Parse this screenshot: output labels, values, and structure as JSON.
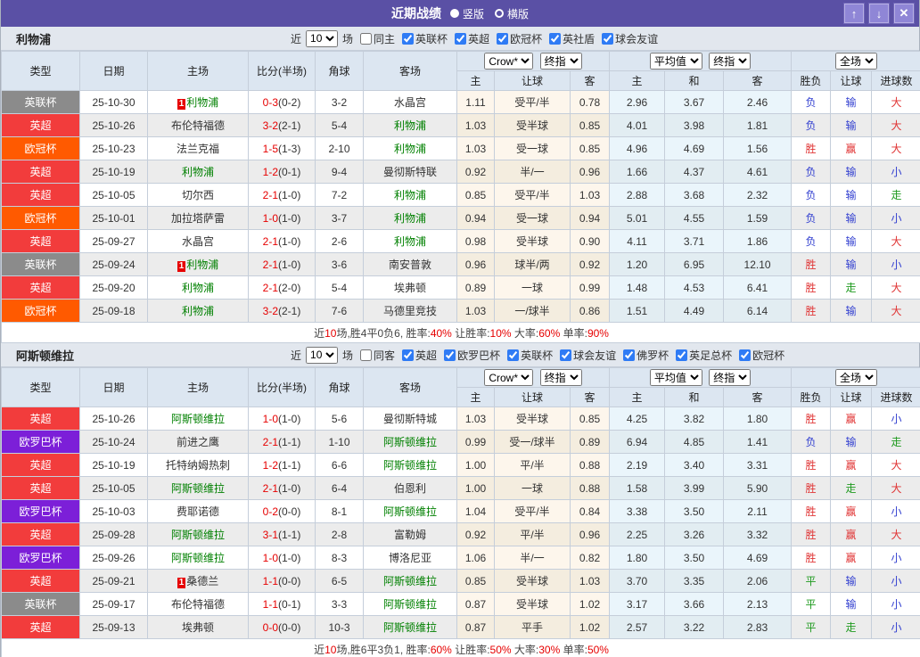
{
  "titlebar": {
    "title": "近期战绩",
    "radio_vertical": "竖版",
    "radio_horizontal": "横版",
    "btn_up": "↑",
    "btn_down": "↓",
    "btn_close": "✕"
  },
  "table_header": {
    "cols": [
      "类型",
      "日期",
      "主场",
      "比分(半场)",
      "角球",
      "客场"
    ],
    "book_select": "Crow*",
    "final_select": "终指",
    "avg_select": "平均值",
    "final_select2": "终指",
    "scope_select": "全场",
    "crow_sub": [
      "主",
      "让球",
      "客"
    ],
    "avg_sub": [
      "主",
      "和",
      "客"
    ],
    "result_sub": [
      "胜负",
      "让球",
      "进球数"
    ]
  },
  "league_colors": {
    "英超": "#F23C3C",
    "英联杯": "#8B8B8B",
    "欧冠杯": "#FF5A00",
    "欧罗巴杯": "#7C1FD8"
  },
  "result_colors": {
    "胜": "c-red",
    "负": "c-blue",
    "平": "c-green",
    "赢": "c-red",
    "输": "c-blue",
    "走": "c-green",
    "大": "c-red",
    "小": "c-blue"
  },
  "sections": [
    {
      "team": "利物浦",
      "filter": {
        "near": "近",
        "games": "10",
        "games_suffix": "场",
        "same": "同主",
        "leagues": [
          "英联杯",
          "英超",
          "欧冠杯",
          "英社盾",
          "球会友谊"
        ]
      },
      "rows": [
        {
          "league": "英联杯",
          "date": "25-10-30",
          "home": "利物浦",
          "home_team": true,
          "home_rank": "1",
          "score": "0-3",
          "half": "(0-2)",
          "corner": "3-2",
          "away": "水晶宫",
          "away_team": false,
          "o1": [
            "1.11",
            "受平/半",
            "0.78"
          ],
          "o2": [
            "2.96",
            "3.67",
            "2.46"
          ],
          "res": [
            "负",
            "输",
            "大"
          ]
        },
        {
          "league": "英超",
          "date": "25-10-26",
          "home": "布伦特福德",
          "home_team": false,
          "score": "3-2",
          "half": "(2-1)",
          "corner": "5-4",
          "away": "利物浦",
          "away_team": true,
          "o1": [
            "1.03",
            "受半球",
            "0.85"
          ],
          "o2": [
            "4.01",
            "3.98",
            "1.81"
          ],
          "res": [
            "负",
            "输",
            "大"
          ]
        },
        {
          "league": "欧冠杯",
          "date": "25-10-23",
          "home": "法兰克福",
          "home_team": false,
          "score": "1-5",
          "half": "(1-3)",
          "corner": "2-10",
          "away": "利物浦",
          "away_team": true,
          "o1": [
            "1.03",
            "受一球",
            "0.85"
          ],
          "o2": [
            "4.96",
            "4.69",
            "1.56"
          ],
          "res": [
            "胜",
            "赢",
            "大"
          ]
        },
        {
          "league": "英超",
          "date": "25-10-19",
          "home": "利物浦",
          "home_team": true,
          "score": "1-2",
          "half": "(0-1)",
          "corner": "9-4",
          "away": "曼彻斯特联",
          "away_team": false,
          "o1": [
            "0.92",
            "半/一",
            "0.96"
          ],
          "o2": [
            "1.66",
            "4.37",
            "4.61"
          ],
          "res": [
            "负",
            "输",
            "小"
          ]
        },
        {
          "league": "英超",
          "date": "25-10-05",
          "home": "切尔西",
          "home_team": false,
          "score": "2-1",
          "half": "(1-0)",
          "corner": "7-2",
          "away": "利物浦",
          "away_team": true,
          "o1": [
            "0.85",
            "受平/半",
            "1.03"
          ],
          "o2": [
            "2.88",
            "3.68",
            "2.32"
          ],
          "res": [
            "负",
            "输",
            "走"
          ]
        },
        {
          "league": "欧冠杯",
          "date": "25-10-01",
          "home": "加拉塔萨雷",
          "home_team": false,
          "score": "1-0",
          "half": "(1-0)",
          "corner": "3-7",
          "away": "利物浦",
          "away_team": true,
          "o1": [
            "0.94",
            "受一球",
            "0.94"
          ],
          "o2": [
            "5.01",
            "4.55",
            "1.59"
          ],
          "res": [
            "负",
            "输",
            "小"
          ]
        },
        {
          "league": "英超",
          "date": "25-09-27",
          "home": "水晶宫",
          "home_team": false,
          "score": "2-1",
          "half": "(1-0)",
          "corner": "2-6",
          "away": "利物浦",
          "away_team": true,
          "o1": [
            "0.98",
            "受半球",
            "0.90"
          ],
          "o2": [
            "4.11",
            "3.71",
            "1.86"
          ],
          "res": [
            "负",
            "输",
            "大"
          ]
        },
        {
          "league": "英联杯",
          "date": "25-09-24",
          "home": "利物浦",
          "home_team": true,
          "home_rank": "1",
          "score": "2-1",
          "half": "(1-0)",
          "corner": "3-6",
          "away": "南安普敦",
          "away_team": false,
          "o1": [
            "0.96",
            "球半/两",
            "0.92"
          ],
          "o2": [
            "1.20",
            "6.95",
            "12.10"
          ],
          "res": [
            "胜",
            "输",
            "小"
          ]
        },
        {
          "league": "英超",
          "date": "25-09-20",
          "home": "利物浦",
          "home_team": true,
          "score": "2-1",
          "half": "(2-0)",
          "corner": "5-4",
          "away": "埃弗顿",
          "away_team": false,
          "o1": [
            "0.89",
            "一球",
            "0.99"
          ],
          "o2": [
            "1.48",
            "4.53",
            "6.41"
          ],
          "res": [
            "胜",
            "走",
            "大"
          ]
        },
        {
          "league": "欧冠杯",
          "date": "25-09-18",
          "home": "利物浦",
          "home_team": true,
          "score": "3-2",
          "half": "(2-1)",
          "corner": "7-6",
          "away": "马德里竞技",
          "away_team": false,
          "o1": [
            "1.03",
            "一/球半",
            "0.86"
          ],
          "o2": [
            "1.51",
            "4.49",
            "6.14"
          ],
          "res": [
            "胜",
            "输",
            "大"
          ]
        }
      ],
      "summary": [
        {
          "text": "近",
          "red": false
        },
        {
          "text": "10",
          "red": true
        },
        {
          "text": "场,胜4平0负6, 胜率:",
          "red": false
        },
        {
          "text": "40%",
          "red": true
        },
        {
          "text": " 让胜率:",
          "red": false
        },
        {
          "text": "10%",
          "red": true
        },
        {
          "text": " 大率:",
          "red": false
        },
        {
          "text": "60%",
          "red": true
        },
        {
          "text": " 单率:",
          "red": false
        },
        {
          "text": "90%",
          "red": true
        }
      ]
    },
    {
      "team": "阿斯顿维拉",
      "filter": {
        "near": "近",
        "games": "10",
        "games_suffix": "场",
        "same": "同客",
        "leagues": [
          "英超",
          "欧罗巴杯",
          "英联杯",
          "球会友谊",
          "佛罗杯",
          "英足总杯",
          "欧冠杯"
        ]
      },
      "rows": [
        {
          "league": "英超",
          "date": "25-10-26",
          "home": "阿斯顿维拉",
          "home_team": true,
          "score": "1-0",
          "half": "(1-0)",
          "corner": "5-6",
          "away": "曼彻斯特城",
          "away_team": false,
          "o1": [
            "1.03",
            "受半球",
            "0.85"
          ],
          "o2": [
            "4.25",
            "3.82",
            "1.80"
          ],
          "res": [
            "胜",
            "赢",
            "小"
          ]
        },
        {
          "league": "欧罗巴杯",
          "date": "25-10-24",
          "home": "前进之鹰",
          "home_team": false,
          "score": "2-1",
          "half": "(1-1)",
          "corner": "1-10",
          "away": "阿斯顿维拉",
          "away_team": true,
          "o1": [
            "0.99",
            "受一/球半",
            "0.89"
          ],
          "o2": [
            "6.94",
            "4.85",
            "1.41"
          ],
          "res": [
            "负",
            "输",
            "走"
          ]
        },
        {
          "league": "英超",
          "date": "25-10-19",
          "home": "托特纳姆热刺",
          "home_team": false,
          "score": "1-2",
          "half": "(1-1)",
          "corner": "6-6",
          "away": "阿斯顿维拉",
          "away_team": true,
          "o1": [
            "1.00",
            "平/半",
            "0.88"
          ],
          "o2": [
            "2.19",
            "3.40",
            "3.31"
          ],
          "res": [
            "胜",
            "赢",
            "大"
          ]
        },
        {
          "league": "英超",
          "date": "25-10-05",
          "home": "阿斯顿维拉",
          "home_team": true,
          "score": "2-1",
          "half": "(1-0)",
          "corner": "6-4",
          "away": "伯恩利",
          "away_team": false,
          "o1": [
            "1.00",
            "一球",
            "0.88"
          ],
          "o2": [
            "1.58",
            "3.99",
            "5.90"
          ],
          "res": [
            "胜",
            "走",
            "大"
          ]
        },
        {
          "league": "欧罗巴杯",
          "date": "25-10-03",
          "home": "费耶诺德",
          "home_team": false,
          "score": "0-2",
          "half": "(0-0)",
          "corner": "8-1",
          "away": "阿斯顿维拉",
          "away_team": true,
          "o1": [
            "1.04",
            "受平/半",
            "0.84"
          ],
          "o2": [
            "3.38",
            "3.50",
            "2.11"
          ],
          "res": [
            "胜",
            "赢",
            "小"
          ]
        },
        {
          "league": "英超",
          "date": "25-09-28",
          "home": "阿斯顿维拉",
          "home_team": true,
          "score": "3-1",
          "half": "(1-1)",
          "corner": "2-8",
          "away": "富勒姆",
          "away_team": false,
          "o1": [
            "0.92",
            "平/半",
            "0.96"
          ],
          "o2": [
            "2.25",
            "3.26",
            "3.32"
          ],
          "res": [
            "胜",
            "赢",
            "大"
          ]
        },
        {
          "league": "欧罗巴杯",
          "date": "25-09-26",
          "home": "阿斯顿维拉",
          "home_team": true,
          "score": "1-0",
          "half": "(1-0)",
          "corner": "8-3",
          "away": "博洛尼亚",
          "away_team": false,
          "o1": [
            "1.06",
            "半/一",
            "0.82"
          ],
          "o2": [
            "1.80",
            "3.50",
            "4.69"
          ],
          "res": [
            "胜",
            "赢",
            "小"
          ]
        },
        {
          "league": "英超",
          "date": "25-09-21",
          "home": "桑德兰",
          "home_team": false,
          "home_rank": "1",
          "score": "1-1",
          "half": "(0-0)",
          "corner": "6-5",
          "away": "阿斯顿维拉",
          "away_team": true,
          "o1": [
            "0.85",
            "受半球",
            "1.03"
          ],
          "o2": [
            "3.70",
            "3.35",
            "2.06"
          ],
          "res": [
            "平",
            "输",
            "小"
          ]
        },
        {
          "league": "英联杯",
          "date": "25-09-17",
          "home": "布伦特福德",
          "home_team": false,
          "score": "1-1",
          "half": "(0-1)",
          "corner": "3-3",
          "away": "阿斯顿维拉",
          "away_team": true,
          "o1": [
            "0.87",
            "受半球",
            "1.02"
          ],
          "o2": [
            "3.17",
            "3.66",
            "2.13"
          ],
          "res": [
            "平",
            "输",
            "小"
          ]
        },
        {
          "league": "英超",
          "date": "25-09-13",
          "home": "埃弗顿",
          "home_team": false,
          "score": "0-0",
          "half": "(0-0)",
          "corner": "10-3",
          "away": "阿斯顿维拉",
          "away_team": true,
          "o1": [
            "0.87",
            "平手",
            "1.02"
          ],
          "o2": [
            "2.57",
            "3.22",
            "2.83"
          ],
          "res": [
            "平",
            "走",
            "小"
          ]
        }
      ],
      "summary": [
        {
          "text": "近",
          "red": false
        },
        {
          "text": "10",
          "red": true
        },
        {
          "text": "场,胜6平3负1, 胜率:",
          "red": false
        },
        {
          "text": "60%",
          "red": true
        },
        {
          "text": " 让胜率:",
          "red": false
        },
        {
          "text": "50%",
          "red": true
        },
        {
          "text": " 大率:",
          "red": false
        },
        {
          "text": "30%",
          "red": true
        },
        {
          "text": " 单率:",
          "red": false
        },
        {
          "text": "50%",
          "red": true
        }
      ]
    }
  ]
}
